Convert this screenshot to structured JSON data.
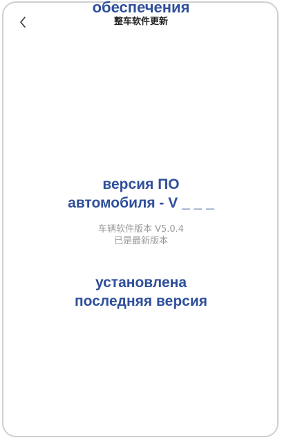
{
  "header": {
    "back_icon": "chevron-left-icon",
    "title": "整车软件更新",
    "overlay_title": "обеспечения"
  },
  "main": {
    "overlay_version_line1": "версия ПО",
    "overlay_version_line2": "автомобиля - V _ _ _",
    "version_text": "车辆软件版本 V5.0.4",
    "status_text": "已是最新版本",
    "overlay_latest_line1": "установлена",
    "overlay_latest_line2": "последняя версия"
  },
  "colors": {
    "overlay_text": "#2f4f9a",
    "title_text": "#222222",
    "info_text": "#9a9a9a",
    "frame_border": "#cfcfcf"
  }
}
